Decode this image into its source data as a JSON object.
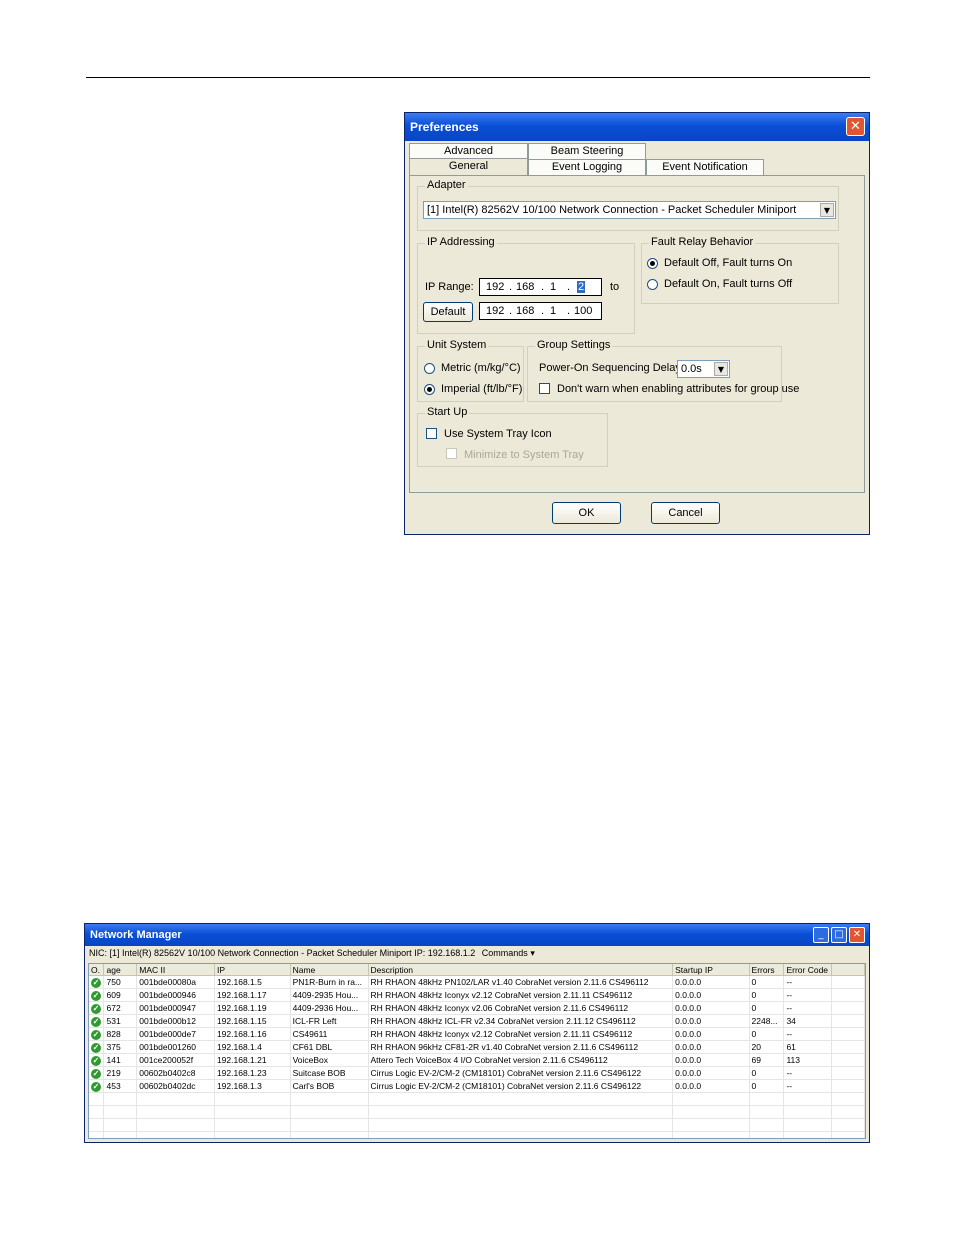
{
  "preferences": {
    "title": "Preferences",
    "tabs_back": [
      "Advanced",
      "Beam Steering"
    ],
    "tabs_front": [
      "General",
      "Event Logging",
      "Event Notification"
    ],
    "adapter": {
      "legend": "Adapter",
      "value": "[1] Intel(R) 82562V 10/100 Network Connection - Packet Scheduler Miniport"
    },
    "ip_addressing": {
      "legend": "IP Addressing",
      "range_label": "IP Range:",
      "to_label": "to",
      "default_button": "Default",
      "start": [
        "192",
        "168",
        "1",
        "2"
      ],
      "end": [
        "192",
        "168",
        "1",
        "100"
      ]
    },
    "fault_relay": {
      "legend": "Fault Relay Behavior",
      "options": [
        "Default Off, Fault turns On",
        "Default On, Fault turns Off"
      ],
      "selected": 0
    },
    "unit_system": {
      "legend": "Unit System",
      "options": [
        "Metric (m/kg/°C)",
        "Imperial (ft/lb/°F)"
      ],
      "selected": 1
    },
    "group_settings": {
      "legend": "Group Settings",
      "delay_label": "Power-On Sequencing Delay:",
      "delay_value": "0.0s",
      "dont_warn_label": "Don't warn when enabling attributes for group use"
    },
    "start_up": {
      "legend": "Start Up",
      "tray_label": "Use System Tray Icon",
      "minimize_label": "Minimize to System Tray"
    },
    "ok_button": "OK",
    "cancel_button": "Cancel"
  },
  "network_manager": {
    "title": "Network Manager",
    "nic_label": "NIC:",
    "nic_value": "[1] Intel(R) 82562V 10/100 Network Connection - Packet Scheduler Miniport",
    "ip_label": "IP:",
    "ip_value": "192.168.1.2",
    "commands_label": "Commands",
    "columns": [
      "O.",
      "age",
      "MAC II",
      "IP",
      "Name",
      "Description",
      "Startup IP",
      "Errors",
      "Error Code"
    ],
    "rows": [
      [
        "750",
        "001bde00080a",
        "192.168.1.5",
        "PN1R-Burn in ra...",
        "RH RHAON 48kHz PN102/LAR v1.40 CobraNet version 2.11.6 CS496112",
        "0.0.0.0",
        "0",
        "--"
      ],
      [
        "609",
        "001bde000946",
        "192.168.1.17",
        "4409-2935 Hou...",
        "RH RHAON 48kHz Iconyx v2.12 CobraNet version 2.11.11 CS496112",
        "0.0.0.0",
        "0",
        "--"
      ],
      [
        "672",
        "001bde000947",
        "192.168.1.19",
        "4409-2936 Hou...",
        "RH RHAON 48kHz Iconyx v2.06 CobraNet version 2.11.6 CS496112",
        "0.0.0.0",
        "0",
        "--"
      ],
      [
        "531",
        "001bde000b12",
        "192.168.1.15",
        "ICL-FR Left",
        "RH RHAON 48kHz ICL-FR v2.34 CobraNet version 2.11.12 CS496112",
        "0.0.0.0",
        "2248...",
        "34"
      ],
      [
        "828",
        "001bde000de7",
        "192.168.1.16",
        "CS49611",
        "RH RHAON 48kHz Iconyx v2.12 CobraNet version 2.11.11 CS496112",
        "0.0.0.0",
        "0",
        "--"
      ],
      [
        "375",
        "001bde001260",
        "192.168.1.4",
        "CF61 DBL",
        "RH RHAON 96kHz CF81-2R v1.40 CobraNet version 2.11.6 CS496112",
        "0.0.0.0",
        "20",
        "61"
      ],
      [
        "141",
        "001ce200052f",
        "192.168.1.21",
        "VoiceBox",
        "Attero Tech VoiceBox 4 I/O CobraNet version 2.11.6 CS496112",
        "0.0.0.0",
        "69",
        "113"
      ],
      [
        "219",
        "00602b0402c8",
        "192.168.1.23",
        "Suitcase BOB",
        "Cirrus Logic EV-2/CM-2 (CM18101) CobraNet version 2.11.6 CS496122",
        "0.0.0.0",
        "0",
        "--"
      ],
      [
        "453",
        "00602b0402dc",
        "192.168.1.3",
        "Carl's BOB",
        "Cirrus Logic EV-2/CM-2 (CM18101) CobraNet version 2.11.6 CS496122",
        "0.0.0.0",
        "0",
        "--"
      ]
    ]
  }
}
